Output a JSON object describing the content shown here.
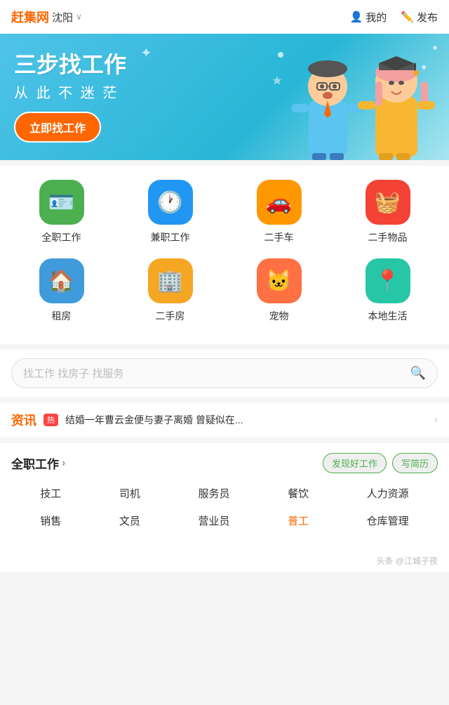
{
  "header": {
    "logo": "赶集网",
    "city": "沈阳",
    "city_arrow": "∨",
    "my_label": "我的",
    "publish_label": "发布"
  },
  "banner": {
    "title": "三步找工作",
    "subtitle": "从 此 不 迷 茫",
    "btn_label": "立即找工作"
  },
  "categories": {
    "row1": [
      {
        "icon": "🪪",
        "label": "全职工作",
        "color": "ic-green"
      },
      {
        "icon": "🕐",
        "label": "兼职工作",
        "color": "ic-blue"
      },
      {
        "icon": "🚗",
        "label": "二手车",
        "color": "ic-orange"
      },
      {
        "icon": "🧺",
        "label": "二手物品",
        "color": "ic-red"
      }
    ],
    "row2": [
      {
        "icon": "🏠",
        "label": "租房",
        "color": "ic-blue2"
      },
      {
        "icon": "🏢",
        "label": "二手房",
        "color": "ic-yellow"
      },
      {
        "icon": "🐱",
        "label": "宠物",
        "color": "ic-orange2"
      },
      {
        "icon": "📍",
        "label": "本地生活",
        "color": "ic-teal"
      }
    ]
  },
  "search": {
    "placeholder": "找工作 找房子 找服务"
  },
  "news": {
    "label": "资讯",
    "hot_badge": "热",
    "text": "结婚一年曹云金便与妻子离婚 曾疑似在..."
  },
  "jobs": {
    "section_title": "全职工作",
    "section_arrow": "›",
    "btn_discover": "发现好工作",
    "btn_resume": "写简历",
    "tags_row1": [
      "技工",
      "司机",
      "服务员",
      "餐饮",
      "人力资源"
    ],
    "tags_row2": [
      "销售",
      "文员",
      "营业员",
      "普工",
      "仓库管理"
    ],
    "highlight_tag": "普工"
  },
  "watermark": "头条 @江城子夜"
}
